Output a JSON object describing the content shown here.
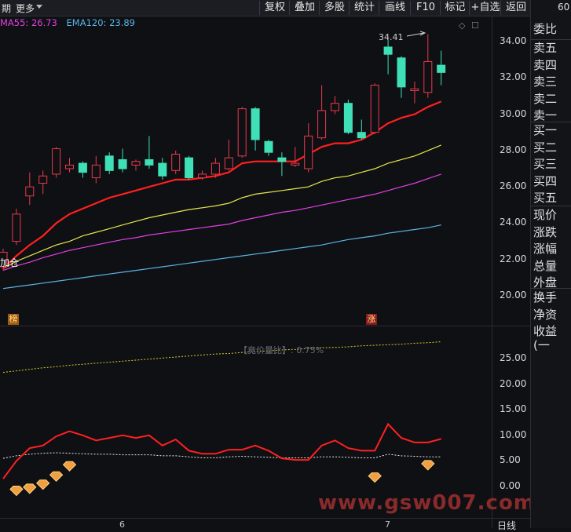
{
  "toolbar": {
    "left_partial": "期",
    "more": "更多",
    "buttons": [
      "复权",
      "叠加",
      "多股",
      "统计",
      "画线",
      "F10",
      "标记",
      "+自选",
      "返回"
    ]
  },
  "right_top": "60",
  "legend": {
    "ma55": "MA55: 26.73",
    "ema120": "EMA120: 23.89"
  },
  "colors": {
    "up": "#e83a4a",
    "down": "#3fe0b8",
    "ma_red": "#ff1f1f",
    "ma_yellow": "#e6e64a",
    "ma_magenta": "#e040e0",
    "ma_blue": "#5ab4e6",
    "dotted_yellow": "#d8c830",
    "ratio_red": "#ff2020"
  },
  "price_axis": [
    "34.00",
    "32.00",
    "30.00",
    "28.00",
    "26.00",
    "24.00",
    "22.00",
    "20.00"
  ],
  "price_axis_values": [
    34,
    32,
    30,
    28,
    26,
    24,
    22,
    20
  ],
  "sub_axis": [
    "25.00",
    "20.00",
    "15.00",
    "10.00",
    "5.00",
    "0.00"
  ],
  "sub_axis_values": [
    25,
    20,
    15,
    10,
    5,
    0
  ],
  "max_label": "34.41",
  "left_mark": "加仓",
  "tag_bang": "榜",
  "tag_zhang": "涨",
  "sub_title": "【竟价量比】: 0.75%",
  "x_labels": [
    "6",
    "7"
  ],
  "period": "日线",
  "watermark": "www.gsw007.com",
  "right_panel": {
    "group1": [
      "委比"
    ],
    "group2": [
      "卖五",
      "卖四",
      "卖三",
      "卖二",
      "卖一"
    ],
    "group3": [
      "买一",
      "买二",
      "买三",
      "买四",
      "买五"
    ],
    "group4": [
      "现价",
      "涨跌",
      "涨幅",
      "总量",
      "外盘"
    ],
    "group5": [
      "换手",
      "净资",
      "收益(一"
    ]
  },
  "chart_data": {
    "type": "candlestick",
    "candles": [
      {
        "o": 21.6,
        "c": 22.4,
        "h": 22.6,
        "l": 21.4
      },
      {
        "o": 23.0,
        "c": 24.5,
        "h": 24.8,
        "l": 22.8
      },
      {
        "o": 25.5,
        "c": 26.0,
        "h": 26.8,
        "l": 25.0
      },
      {
        "o": 26.2,
        "c": 26.6,
        "h": 26.9,
        "l": 25.6
      },
      {
        "o": 26.7,
        "c": 28.1,
        "h": 28.2,
        "l": 26.5
      },
      {
        "o": 27.0,
        "c": 27.2,
        "h": 27.6,
        "l": 26.8
      },
      {
        "o": 27.3,
        "c": 26.8,
        "h": 27.4,
        "l": 26.5
      },
      {
        "o": 26.5,
        "c": 27.2,
        "h": 27.7,
        "l": 26.2
      },
      {
        "o": 27.7,
        "c": 26.9,
        "h": 27.9,
        "l": 26.7
      },
      {
        "o": 27.5,
        "c": 27.0,
        "h": 28.1,
        "l": 26.8
      },
      {
        "o": 27.2,
        "c": 27.4,
        "h": 27.5,
        "l": 26.9
      },
      {
        "o": 27.5,
        "c": 27.2,
        "h": 28.8,
        "l": 27.0
      },
      {
        "o": 27.3,
        "c": 26.6,
        "h": 27.6,
        "l": 26.4
      },
      {
        "o": 26.9,
        "c": 27.8,
        "h": 28.0,
        "l": 26.7
      },
      {
        "o": 27.6,
        "c": 26.5,
        "h": 27.7,
        "l": 26.4
      },
      {
        "o": 26.5,
        "c": 26.7,
        "h": 26.9,
        "l": 26.4
      },
      {
        "o": 26.7,
        "c": 27.3,
        "h": 27.6,
        "l": 26.5
      },
      {
        "o": 27.0,
        "c": 27.6,
        "h": 28.6,
        "l": 26.9
      },
      {
        "o": 27.7,
        "c": 30.3,
        "h": 30.4,
        "l": 27.6
      },
      {
        "o": 30.3,
        "c": 28.6,
        "h": 30.4,
        "l": 28.0
      },
      {
        "o": 28.5,
        "c": 27.9,
        "h": 28.6,
        "l": 27.7
      },
      {
        "o": 27.6,
        "c": 27.4,
        "h": 27.9,
        "l": 26.6
      },
      {
        "o": 27.2,
        "c": 27.3,
        "h": 28.2,
        "l": 27.1
      },
      {
        "o": 27.0,
        "c": 28.8,
        "h": 29.5,
        "l": 26.8
      },
      {
        "o": 28.7,
        "c": 30.2,
        "h": 31.6,
        "l": 28.6
      },
      {
        "o": 30.2,
        "c": 30.6,
        "h": 31.0,
        "l": 30.0
      },
      {
        "o": 30.6,
        "c": 29.0,
        "h": 30.8,
        "l": 28.9
      },
      {
        "o": 29.0,
        "c": 28.7,
        "h": 29.7,
        "l": 28.6
      },
      {
        "o": 29.0,
        "c": 31.6,
        "h": 31.7,
        "l": 28.9
      },
      {
        "o": 33.7,
        "c": 33.3,
        "h": 34.1,
        "l": 32.2
      },
      {
        "o": 33.1,
        "c": 31.5,
        "h": 33.2,
        "l": 30.9
      },
      {
        "o": 31.3,
        "c": 31.4,
        "h": 31.8,
        "l": 30.6
      },
      {
        "o": 31.2,
        "c": 32.9,
        "h": 34.41,
        "l": 30.9
      },
      {
        "o": 32.7,
        "c": 32.3,
        "h": 33.5,
        "l": 31.6
      }
    ],
    "ma_red": [
      21.5,
      22.2,
      22.8,
      23.3,
      24.0,
      24.5,
      24.8,
      25.1,
      25.4,
      25.6,
      25.8,
      26.0,
      26.2,
      26.4,
      26.4,
      26.5,
      26.6,
      26.8,
      27.3,
      27.4,
      27.4,
      27.4,
      27.4,
      27.8,
      28.2,
      28.4,
      28.4,
      28.6,
      29.0,
      29.5,
      29.8,
      30.0,
      30.4,
      30.7
    ],
    "ma_yellow": [
      21.5,
      21.9,
      22.2,
      22.5,
      22.8,
      23.0,
      23.3,
      23.5,
      23.7,
      23.9,
      24.1,
      24.3,
      24.45,
      24.6,
      24.75,
      24.85,
      24.95,
      25.1,
      25.4,
      25.6,
      25.7,
      25.8,
      25.9,
      26.0,
      26.3,
      26.5,
      26.6,
      26.8,
      27.0,
      27.3,
      27.5,
      27.7,
      28.0,
      28.3
    ],
    "ma_magenta": [
      21.4,
      21.65,
      21.85,
      22.1,
      22.3,
      22.5,
      22.65,
      22.8,
      22.95,
      23.1,
      23.2,
      23.35,
      23.45,
      23.55,
      23.65,
      23.75,
      23.85,
      23.95,
      24.15,
      24.3,
      24.45,
      24.6,
      24.7,
      24.85,
      25.0,
      25.15,
      25.3,
      25.45,
      25.6,
      25.8,
      26.0,
      26.2,
      26.45,
      26.7
    ],
    "ma_blue": [
      20.4,
      20.5,
      20.6,
      20.7,
      20.8,
      20.9,
      21.0,
      21.1,
      21.2,
      21.3,
      21.4,
      21.5,
      21.6,
      21.7,
      21.8,
      21.9,
      22.0,
      22.1,
      22.2,
      22.3,
      22.4,
      22.5,
      22.6,
      22.7,
      22.8,
      22.95,
      23.1,
      23.2,
      23.3,
      23.45,
      23.55,
      23.65,
      23.75,
      23.9
    ],
    "ratio_red": [
      1.5,
      5.0,
      7.5,
      8.0,
      9.8,
      10.8,
      10.0,
      9.0,
      9.5,
      10.0,
      9.5,
      10.0,
      8.0,
      9.2,
      7.0,
      6.4,
      6.4,
      7.2,
      7.2,
      8.0,
      7.0,
      5.5,
      5.2,
      5.2,
      8.0,
      9.0,
      7.5,
      7.0,
      7.0,
      12.2,
      9.5,
      8.6,
      8.6,
      9.3
    ],
    "ratio_white": [
      5.5,
      6.0,
      6.3,
      6.5,
      6.6,
      6.5,
      6.4,
      6.3,
      6.3,
      6.2,
      6.2,
      6.2,
      6.0,
      6.0,
      5.8,
      5.6,
      5.6,
      5.8,
      5.9,
      5.8,
      5.7,
      5.6,
      5.6,
      5.6,
      5.8,
      5.8,
      5.7,
      5.6,
      5.6,
      6.3,
      6.0,
      5.9,
      5.8,
      5.8
    ],
    "dotted_yellow": [
      22.3,
      22.6,
      22.9,
      23.2,
      23.4,
      23.7,
      23.9,
      24.1,
      24.3,
      24.5,
      24.7,
      24.9,
      25.1,
      25.3,
      25.5,
      25.7,
      25.9,
      26.0,
      26.2,
      26.4,
      26.5,
      26.7,
      26.8,
      27.0,
      27.1,
      27.2,
      27.3,
      27.5,
      27.6,
      27.7,
      27.8,
      28.0,
      28.1,
      28.3
    ],
    "diamonds": [
      {
        "i": 1,
        "v": -1.0
      },
      {
        "i": 2,
        "v": -0.6
      },
      {
        "i": 3,
        "v": 0.2
      },
      {
        "i": 4,
        "v": 1.8
      },
      {
        "i": 5,
        "v": 3.8
      },
      {
        "i": 28,
        "v": 1.6
      },
      {
        "i": 32,
        "v": 4.0
      }
    ],
    "price_ylim": [
      19.5,
      35.2
    ],
    "sub_ylim": [
      -2.5,
      29.5
    ]
  }
}
